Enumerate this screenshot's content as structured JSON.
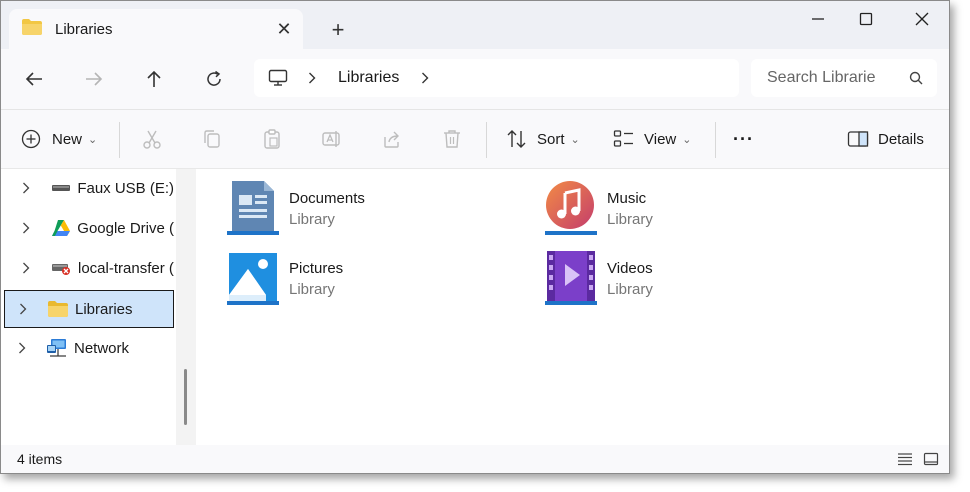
{
  "tab": {
    "title": "Libraries",
    "close": "✕",
    "new_tab": "+"
  },
  "window_controls": {
    "minimize": "—",
    "maximize": "☐",
    "close": "✕"
  },
  "address": {
    "crumbs": [
      "Libraries"
    ],
    "search_placeholder": "Search Librarie"
  },
  "toolbar": {
    "new_label": "New",
    "sort_label": "Sort",
    "view_label": "View",
    "more_label": "···",
    "details_label": "Details",
    "chevron": "⌄"
  },
  "sidebar": {
    "items": [
      {
        "label": "Faux USB (E:)",
        "icon": "usb-drive-icon"
      },
      {
        "label": "Google Drive (",
        "icon": "google-drive-icon"
      },
      {
        "label": "local-transfer (",
        "icon": "network-drive-disconnected-icon"
      },
      {
        "label": "Libraries",
        "icon": "libraries-folder-icon",
        "selected": true
      },
      {
        "label": "Network",
        "icon": "network-icon"
      }
    ]
  },
  "libraries": [
    {
      "name": "Documents",
      "type": "Library",
      "icon": "documents-library-icon"
    },
    {
      "name": "Music",
      "type": "Library",
      "icon": "music-library-icon"
    },
    {
      "name": "Pictures",
      "type": "Library",
      "icon": "pictures-library-icon"
    },
    {
      "name": "Videos",
      "type": "Library",
      "icon": "videos-library-icon"
    }
  ],
  "status": {
    "item_count": "4 items"
  },
  "colors": {
    "accent": "#0a67c2",
    "selection": "#cfe4fa",
    "folder": "#f2c744"
  }
}
